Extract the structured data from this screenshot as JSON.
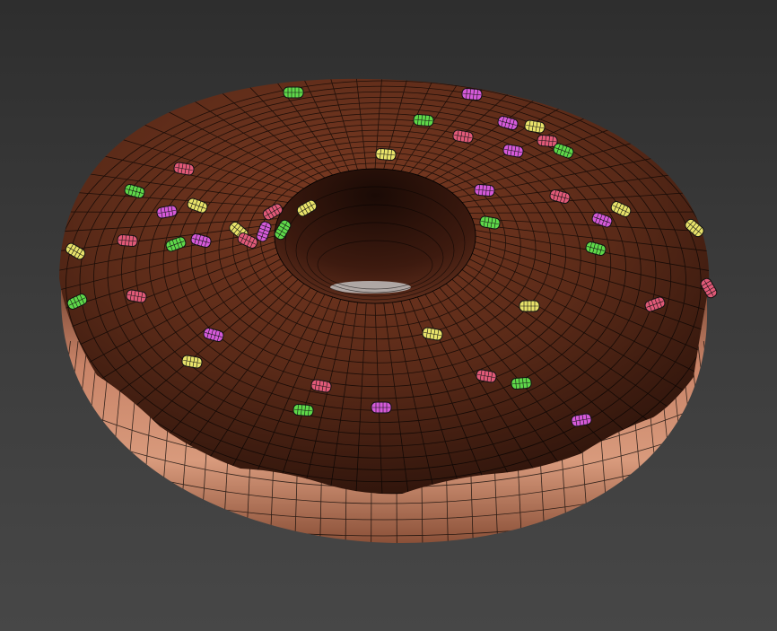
{
  "viewport": {
    "background_top": "#2e2e2e",
    "background_bottom": "#474747"
  },
  "model": {
    "object": "donut",
    "render_mode": "wireframe-on-shaded",
    "colors": {
      "dough": "#d08a6a",
      "dough_shadow": "#6a3b2a",
      "icing": "#5a2a18",
      "icing_highlight": "#7a3a22",
      "icing_shadow": "#2a120a",
      "hole_inner": "#3d1a0f",
      "wire": "#000000"
    },
    "sprinkles": [
      {
        "color": "#e05a78"
      },
      {
        "color": "#5fd84a"
      },
      {
        "color": "#d45ad8"
      },
      {
        "color": "#e8e26a"
      },
      {
        "color": "#e05a78"
      },
      {
        "color": "#5fd84a"
      },
      {
        "color": "#d45ad8"
      },
      {
        "color": "#e8e26a"
      },
      {
        "color": "#e05a78"
      },
      {
        "color": "#5fd84a"
      },
      {
        "color": "#d45ad8"
      },
      {
        "color": "#e8e26a"
      }
    ]
  }
}
